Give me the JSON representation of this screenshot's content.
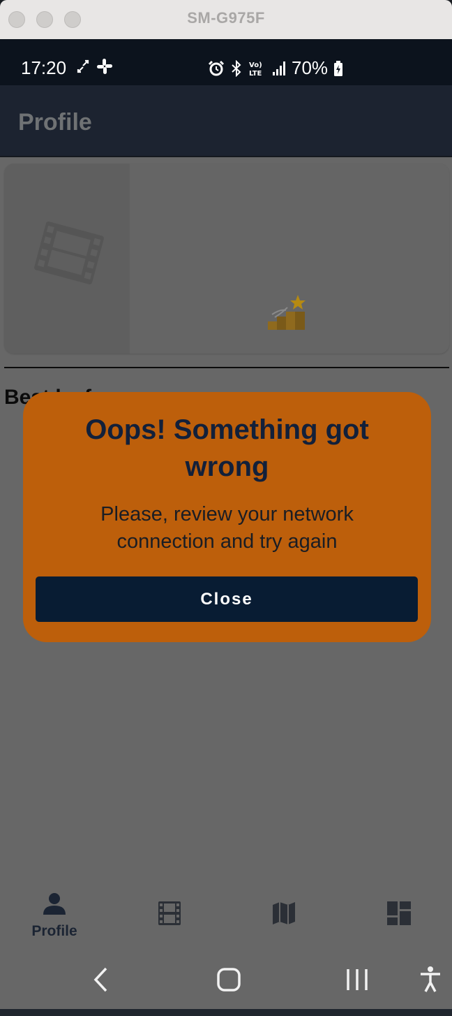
{
  "window": {
    "title": "SM-G975F"
  },
  "status_bar": {
    "time": "17:20",
    "battery": "70%",
    "left_icons": [
      "sync-icon",
      "slack-icon"
    ],
    "right_icons": [
      "alarm-icon",
      "bluetooth-icon",
      "volte-icon",
      "signal-icon",
      "battery-charging-icon"
    ]
  },
  "app_bar": {
    "title": "Profile"
  },
  "content": {
    "card_icons": [
      "film-icon",
      "ladder-star-icon"
    ],
    "section_title": "Best l... f..."
  },
  "dialog": {
    "title": "Oops! Something got wrong",
    "message": "Please, review your network connection and try again",
    "button": "Close",
    "colors": {
      "background": "#bd5f0b",
      "button": "#081c33",
      "title": "#12203a"
    }
  },
  "bottom_nav": {
    "items": [
      {
        "label": "Profile",
        "icon": "person-icon",
        "active": true
      },
      {
        "label": "",
        "icon": "film-icon",
        "active": false
      },
      {
        "label": "",
        "icon": "map-icon",
        "active": false
      },
      {
        "label": "",
        "icon": "dashboard-icon",
        "active": false
      }
    ]
  },
  "system_nav": [
    "back-icon",
    "home-icon",
    "recents-icon",
    "accessibility-icon"
  ]
}
